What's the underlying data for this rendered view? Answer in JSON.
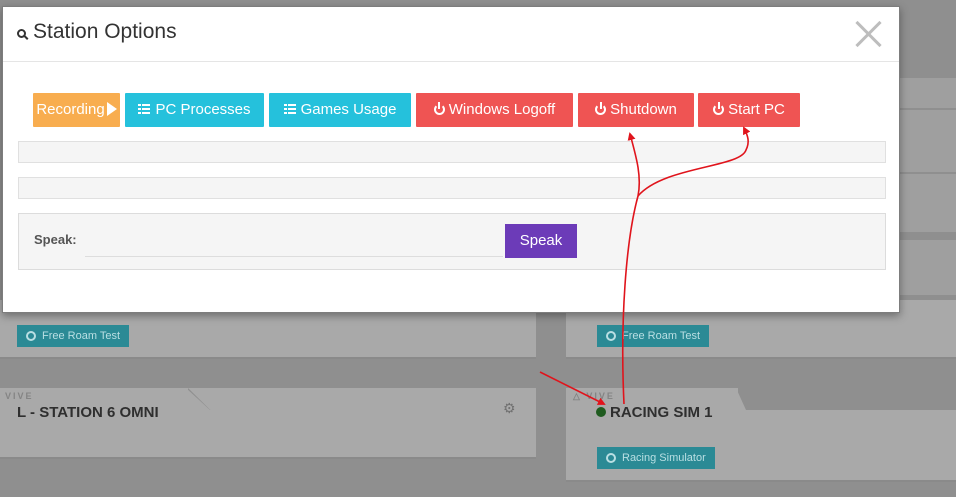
{
  "modal": {
    "title": "Station Options",
    "title_icon": "search-icon",
    "close_icon": "close-icon",
    "buttons": [
      {
        "label": "Recording",
        "icon": "play-icon",
        "color": "#f8ad4f"
      },
      {
        "label": "PC Processes",
        "icon": "list-icon",
        "color": "#25c1dc"
      },
      {
        "label": "Games Usage",
        "icon": "list-icon",
        "color": "#25c1dc"
      },
      {
        "label": "Windows Logoff",
        "icon": "power-icon",
        "color": "#ef5453"
      },
      {
        "label": "Shutdown",
        "icon": "power-icon",
        "color": "#ef5453"
      },
      {
        "label": "Start PC",
        "icon": "power-icon",
        "color": "#ef5453"
      }
    ],
    "speak": {
      "label": "Speak:",
      "input_value": "",
      "button_label": "Speak",
      "button_color": "#6c3bb8"
    }
  },
  "background": {
    "stations": [
      {
        "brand": "VIVE",
        "title": "L - STATION 6 OMNI",
        "tag": "Free Roam Test",
        "settings_icon": "gear-icon"
      },
      {
        "brand": "VIVE",
        "title": "RACING SIM 1",
        "status_icon": "online-dot-icon",
        "tag": "Racing Simulator"
      }
    ],
    "upper_tags": [
      "Free Roam Test",
      "Free Roam Test"
    ]
  },
  "annotation": {
    "color": "#e0141c"
  }
}
